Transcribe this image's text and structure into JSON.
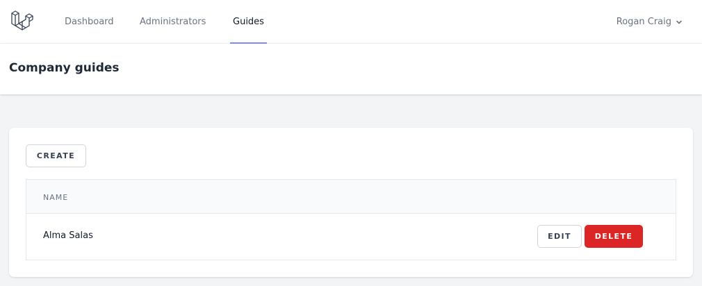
{
  "nav": {
    "links": [
      {
        "label": "Dashboard",
        "active": false
      },
      {
        "label": "Administrators",
        "active": false
      },
      {
        "label": "Guides",
        "active": true
      }
    ],
    "user_name": "Rogan Craig",
    "accent_color": "#818cf8"
  },
  "page": {
    "title": "Company guides"
  },
  "toolbar": {
    "create_label": "CREATE"
  },
  "table": {
    "columns": [
      "NAME"
    ],
    "rows": [
      {
        "name": "Alma Salas",
        "edit_label": "EDIT",
        "delete_label": "DELETE"
      }
    ]
  },
  "colors": {
    "danger": "#dc2626",
    "background": "#f3f4f6"
  },
  "icons": {
    "logo": "laravel-logo-icon",
    "user_menu": "chevron-down-icon"
  }
}
